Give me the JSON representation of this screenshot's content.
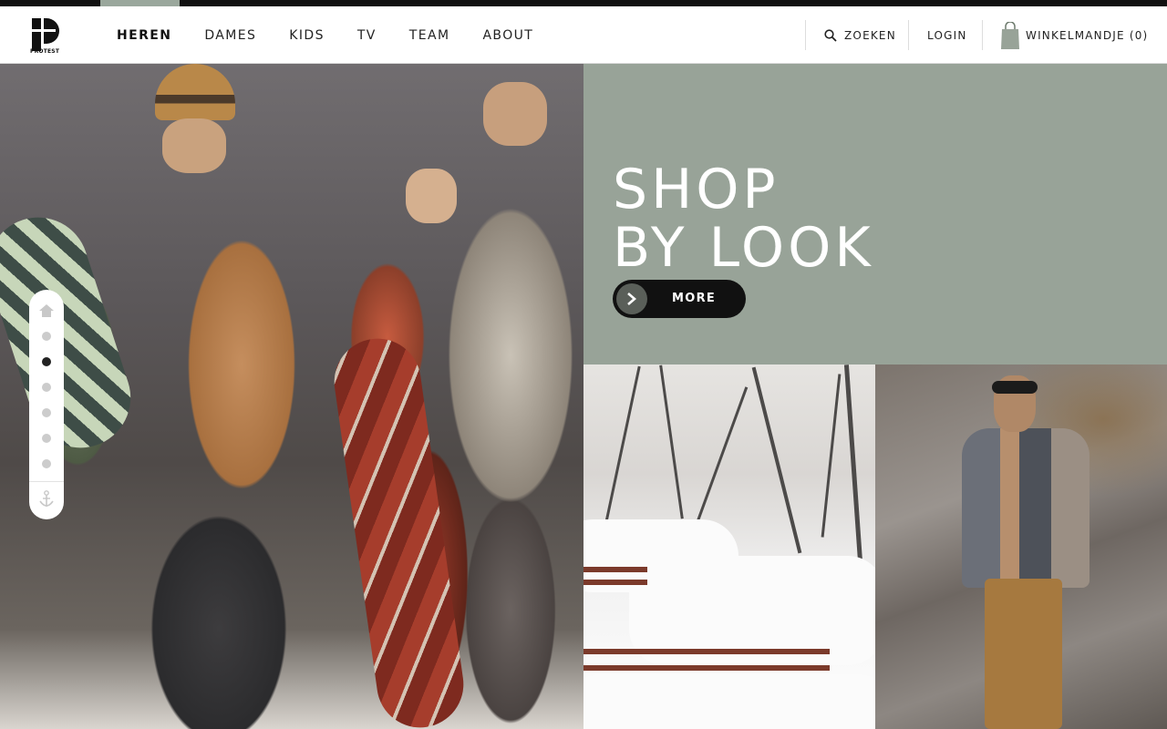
{
  "brand": {
    "logo_text": "PROTEST"
  },
  "nav": {
    "items": [
      {
        "label": "HEREN",
        "active": true
      },
      {
        "label": "DAMES",
        "active": false
      },
      {
        "label": "KIDS",
        "active": false
      },
      {
        "label": "TV",
        "active": false
      },
      {
        "label": "TEAM",
        "active": false
      },
      {
        "label": "ABOUT",
        "active": false
      }
    ]
  },
  "utility": {
    "search_label": "ZOEKEN",
    "login_label": "LOGIN",
    "cart_label": "WINKELMANDJE (0)"
  },
  "hero": {
    "title_line1": "SHOP",
    "title_line2": "BY LOOK",
    "cta_label": "MORE"
  },
  "side_nav": {
    "dot_count": 6,
    "active_index": 1
  },
  "colors": {
    "accent_green": "#98a398",
    "active_tab_marker": "#9aa79c",
    "top_strip": "#111111"
  }
}
